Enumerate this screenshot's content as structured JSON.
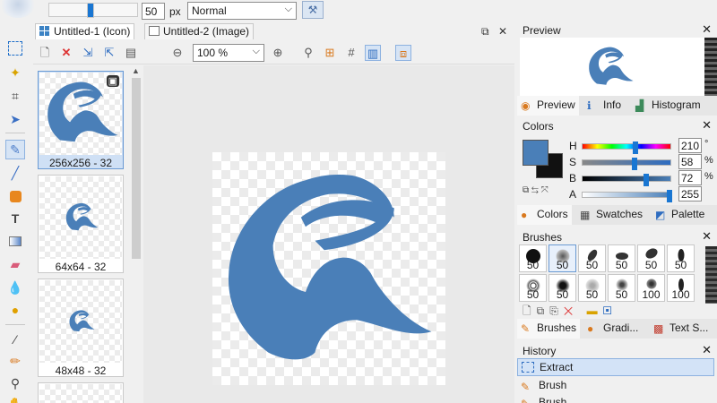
{
  "top_toolbar": {
    "brush_size": "50",
    "size_unit": "px",
    "blend_mode": "Normal"
  },
  "tabs": [
    {
      "label": "Untitled-1 (Icon)"
    },
    {
      "label": "Untitled-2 (Image)"
    }
  ],
  "tab_controls": {
    "restore": "⧉",
    "close": "✕"
  },
  "editor_toolbar": {
    "zoom": "100 %"
  },
  "thumbnails": [
    {
      "caption": "256x256 - 32"
    },
    {
      "caption": "64x64 - 32"
    },
    {
      "caption": "48x48 - 32"
    }
  ],
  "colors": {
    "accent": "#1976d2",
    "logo": "#4a7fb8"
  },
  "panels": {
    "preview": {
      "title": "Preview",
      "tabs": [
        {
          "label": "Preview"
        },
        {
          "label": "Info"
        },
        {
          "label": "Histogram"
        }
      ]
    },
    "colors": {
      "title": "Colors",
      "channels": [
        {
          "label": "H",
          "value": "210",
          "unit": "°",
          "level": 0.6
        },
        {
          "label": "S",
          "value": "58",
          "unit": "%",
          "level": 0.58
        },
        {
          "label": "B",
          "value": "72",
          "unit": "%",
          "level": 0.72
        },
        {
          "label": "A",
          "value": "255",
          "unit": "",
          "level": 1.0
        }
      ],
      "tabs": [
        {
          "label": "Colors"
        },
        {
          "label": "Swatches"
        },
        {
          "label": "Palette"
        }
      ]
    },
    "brushes": {
      "title": "Brushes",
      "sizes": [
        "50",
        "50",
        "50",
        "50",
        "50",
        "50",
        "50",
        "50",
        "50",
        "50",
        "100",
        "100"
      ],
      "tabs": [
        {
          "label": "Brushes"
        },
        {
          "label": "Gradi..."
        },
        {
          "label": "Text S..."
        }
      ]
    },
    "history": {
      "title": "History",
      "items": [
        {
          "label": "Extract"
        },
        {
          "label": "Brush"
        },
        {
          "label": "Brush"
        }
      ]
    }
  }
}
